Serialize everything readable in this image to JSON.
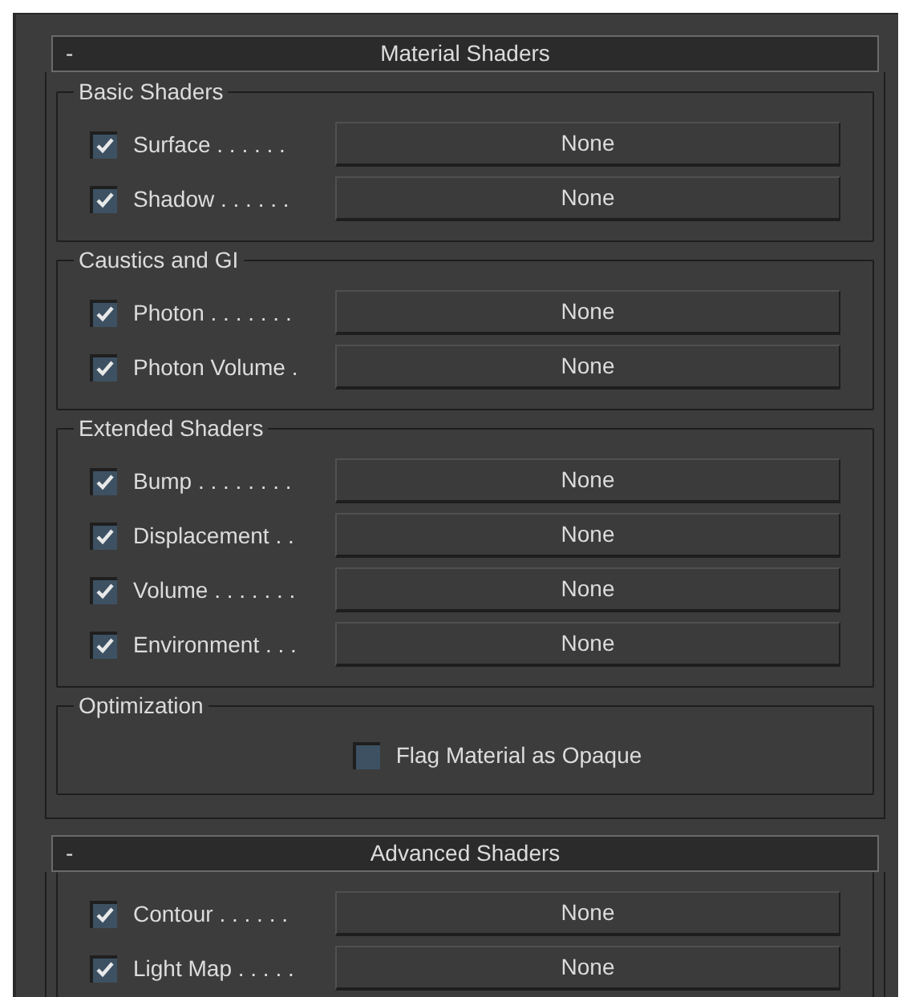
{
  "rollouts": [
    {
      "toggle": "-",
      "title": "Material Shaders",
      "groups": [
        {
          "title": "Basic Shaders",
          "rows": [
            {
              "kind": "shader",
              "label": "Surface . . . . . .",
              "checked": true,
              "value": "None"
            },
            {
              "kind": "shader",
              "label": "Shadow . . . . . .",
              "checked": true,
              "value": "None"
            }
          ]
        },
        {
          "title": "Caustics and GI",
          "rows": [
            {
              "kind": "shader",
              "label": "Photon . . . . . . .",
              "checked": true,
              "value": "None"
            },
            {
              "kind": "shader",
              "label": "Photon Volume .",
              "checked": true,
              "value": "None"
            }
          ]
        },
        {
          "title": "Extended Shaders",
          "rows": [
            {
              "kind": "shader",
              "label": "Bump . . . . . . . .",
              "checked": true,
              "value": "None"
            },
            {
              "kind": "shader",
              "label": "Displacement . .",
              "checked": true,
              "value": "None"
            },
            {
              "kind": "shader",
              "label": "Volume . . . . . . .",
              "checked": true,
              "value": "None"
            },
            {
              "kind": "shader",
              "label": "Environment . . .",
              "checked": true,
              "value": "None"
            }
          ]
        },
        {
          "title": "Optimization",
          "rows": [
            {
              "kind": "flag",
              "label": "Flag Material as Opaque",
              "checked": false
            }
          ]
        }
      ]
    },
    {
      "toggle": "-",
      "title": "Advanced Shaders",
      "groups": [
        {
          "rows": [
            {
              "kind": "shader",
              "label": "Contour . . . . . .",
              "checked": true,
              "value": "None"
            },
            {
              "kind": "shader",
              "label": "Light Map . . . . .",
              "checked": true,
              "value": "None"
            }
          ]
        }
      ]
    }
  ]
}
